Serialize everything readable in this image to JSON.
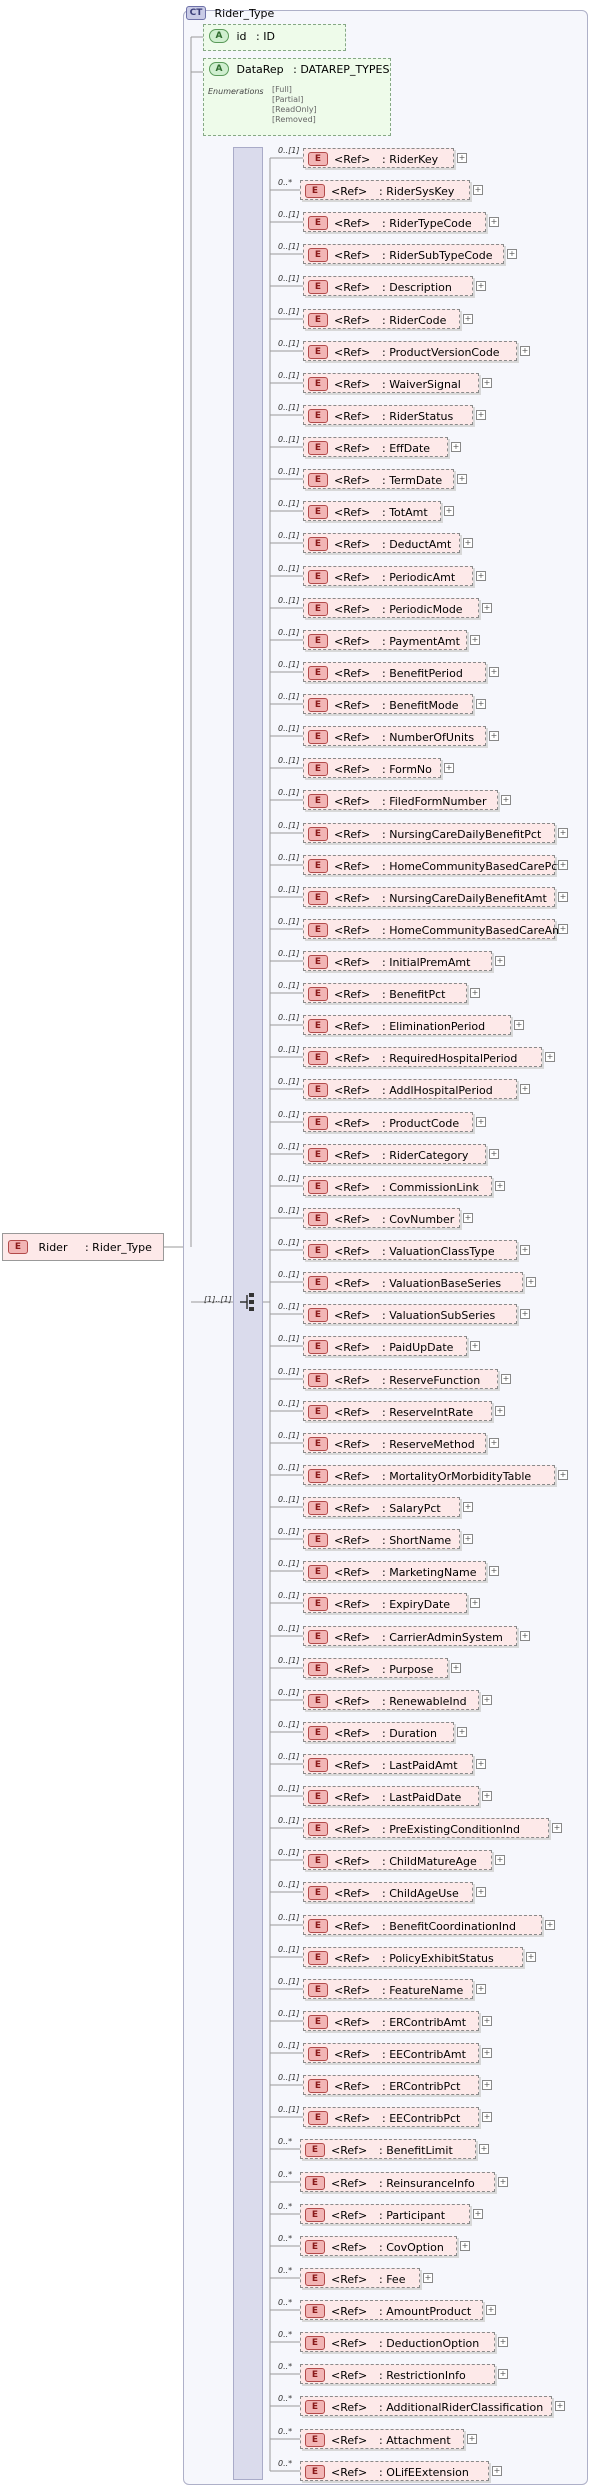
{
  "complex_type": {
    "tag": "CT",
    "name": "Rider_Type"
  },
  "attributes": [
    {
      "tag": "A",
      "name": "id",
      "type": ": ID"
    },
    {
      "tag": "A",
      "name": "DataRep",
      "type": ": DATAREP_TYPES",
      "enum_label": "Enumerations",
      "enumerations": [
        "[Full]",
        "[Partial]",
        "[ReadOnly]",
        "[Removed]"
      ]
    }
  ],
  "root_element": {
    "tag": "E",
    "name": "Rider",
    "type": ": Rider_Type"
  },
  "sequence": {
    "occurrence": "[1]..[1]"
  },
  "children": [
    {
      "occ": "0..[1]",
      "name": ": RiderKey"
    },
    {
      "occ": "0..*",
      "name": ": RiderSysKey"
    },
    {
      "occ": "0..[1]",
      "name": ": RiderTypeCode"
    },
    {
      "occ": "0..[1]",
      "name": ": RiderSubTypeCode"
    },
    {
      "occ": "0..[1]",
      "name": ": Description"
    },
    {
      "occ": "0..[1]",
      "name": ": RiderCode"
    },
    {
      "occ": "0..[1]",
      "name": ": ProductVersionCode"
    },
    {
      "occ": "0..[1]",
      "name": ": WaiverSignal"
    },
    {
      "occ": "0..[1]",
      "name": ": RiderStatus"
    },
    {
      "occ": "0..[1]",
      "name": ": EffDate"
    },
    {
      "occ": "0..[1]",
      "name": ": TermDate"
    },
    {
      "occ": "0..[1]",
      "name": ": TotAmt"
    },
    {
      "occ": "0..[1]",
      "name": ": DeductAmt"
    },
    {
      "occ": "0..[1]",
      "name": ": PeriodicAmt"
    },
    {
      "occ": "0..[1]",
      "name": ": PeriodicMode"
    },
    {
      "occ": "0..[1]",
      "name": ": PaymentAmt"
    },
    {
      "occ": "0..[1]",
      "name": ": BenefitPeriod"
    },
    {
      "occ": "0..[1]",
      "name": ": BenefitMode"
    },
    {
      "occ": "0..[1]",
      "name": ": NumberOfUnits"
    },
    {
      "occ": "0..[1]",
      "name": ": FormNo"
    },
    {
      "occ": "0..[1]",
      "name": ": FiledFormNumber"
    },
    {
      "occ": "0..[1]",
      "name": ": NursingCareDailyBenefitPct"
    },
    {
      "occ": "0..[1]",
      "name": ": HomeCommunityBasedCarePct"
    },
    {
      "occ": "0..[1]",
      "name": ": NursingCareDailyBenefitAmt"
    },
    {
      "occ": "0..[1]",
      "name": ": HomeCommunityBasedCareAmt"
    },
    {
      "occ": "0..[1]",
      "name": ": InitialPremAmt"
    },
    {
      "occ": "0..[1]",
      "name": ": BenefitPct"
    },
    {
      "occ": "0..[1]",
      "name": ": EliminationPeriod"
    },
    {
      "occ": "0..[1]",
      "name": ": RequiredHospitalPeriod"
    },
    {
      "occ": "0..[1]",
      "name": ": AddlHospitalPeriod"
    },
    {
      "occ": "0..[1]",
      "name": ": ProductCode"
    },
    {
      "occ": "0..[1]",
      "name": ": RiderCategory"
    },
    {
      "occ": "0..[1]",
      "name": ": CommissionLink"
    },
    {
      "occ": "0..[1]",
      "name": ": CovNumber"
    },
    {
      "occ": "0..[1]",
      "name": ": ValuationClassType"
    },
    {
      "occ": "0..[1]",
      "name": ": ValuationBaseSeries"
    },
    {
      "occ": "0..[1]",
      "name": ": ValuationSubSeries"
    },
    {
      "occ": "0..[1]",
      "name": ": PaidUpDate"
    },
    {
      "occ": "0..[1]",
      "name": ": ReserveFunction"
    },
    {
      "occ": "0..[1]",
      "name": ": ReserveIntRate"
    },
    {
      "occ": "0..[1]",
      "name": ": ReserveMethod"
    },
    {
      "occ": "0..[1]",
      "name": ": MortalityOrMorbidityTable"
    },
    {
      "occ": "0..[1]",
      "name": ": SalaryPct"
    },
    {
      "occ": "0..[1]",
      "name": ": ShortName"
    },
    {
      "occ": "0..[1]",
      "name": ": MarketingName"
    },
    {
      "occ": "0..[1]",
      "name": ": ExpiryDate"
    },
    {
      "occ": "0..[1]",
      "name": ": CarrierAdminSystem"
    },
    {
      "occ": "0..[1]",
      "name": ": Purpose"
    },
    {
      "occ": "0..[1]",
      "name": ": RenewableInd"
    },
    {
      "occ": "0..[1]",
      "name": ": Duration"
    },
    {
      "occ": "0..[1]",
      "name": ": LastPaidAmt"
    },
    {
      "occ": "0..[1]",
      "name": ": LastPaidDate"
    },
    {
      "occ": "0..[1]",
      "name": ": PreExistingConditionInd"
    },
    {
      "occ": "0..[1]",
      "name": ": ChildMatureAge"
    },
    {
      "occ": "0..[1]",
      "name": ": ChildAgeUse"
    },
    {
      "occ": "0..[1]",
      "name": ": BenefitCoordinationInd"
    },
    {
      "occ": "0..[1]",
      "name": ": PolicyExhibitStatus"
    },
    {
      "occ": "0..[1]",
      "name": ": FeatureName"
    },
    {
      "occ": "0..[1]",
      "name": ": ERContribAmt"
    },
    {
      "occ": "0..[1]",
      "name": ": EEContribAmt"
    },
    {
      "occ": "0..[1]",
      "name": ": ERContribPct"
    },
    {
      "occ": "0..[1]",
      "name": ": EEContribPct"
    },
    {
      "occ": "0..*",
      "name": ": BenefitLimit"
    },
    {
      "occ": "0..*",
      "name": ": ReinsuranceInfo"
    },
    {
      "occ": "0..*",
      "name": ": Participant"
    },
    {
      "occ": "0..*",
      "name": ": CovOption"
    },
    {
      "occ": "0..*",
      "name": ": Fee"
    },
    {
      "occ": "0..*",
      "name": ": AmountProduct"
    },
    {
      "occ": "0..*",
      "name": ": DeductionOption"
    },
    {
      "occ": "0..*",
      "name": ": RestrictionInfo"
    },
    {
      "occ": "0..*",
      "name": ": AdditionalRiderClassification"
    },
    {
      "occ": "0..*",
      "name": ": Attachment"
    },
    {
      "occ": "0..*",
      "name": ": OLifEExtension"
    }
  ],
  "labels": {
    "element_tag": "E",
    "ref": "<Ref>",
    "plus": "+"
  }
}
